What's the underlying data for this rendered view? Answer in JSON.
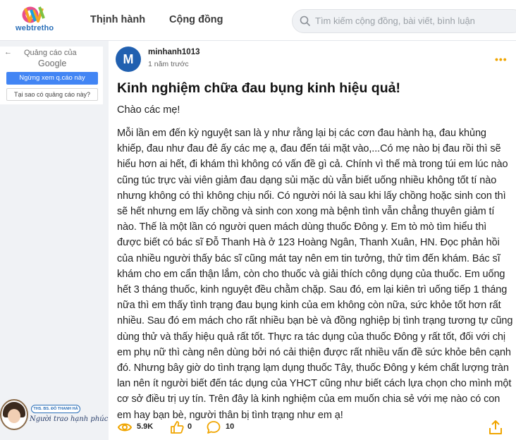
{
  "header": {
    "logo_text": "webtretho",
    "nav": [
      "Thịnh hành",
      "Cộng đồng"
    ],
    "search_placeholder": "Tìm kiếm cộng đồng, bài viết, bình luận"
  },
  "ad": {
    "back_arrow": "←",
    "label": "Quảng cáo của",
    "google": "Google",
    "stop_button": "Ngừng xem q.cáo này",
    "why_button": "Tại sao có quảng cáo này?"
  },
  "brand": {
    "tag": "THS. BS. ĐỖ THANH HÀ",
    "script": "Người trao hạnh phúc"
  },
  "post": {
    "avatar_letter": "M",
    "author": "minhanh1013",
    "time": "1 năm trước",
    "more": "•••",
    "title": "Kinh nghiệm chữa đau bụng kinh hiệu quả!",
    "greeting": "Chào các mẹ!",
    "body": "Mỗi lần em đến kỳ nguyệt san là y như rằng lại bị các cơn đau hành hạ, đau khủng khiếp, đau như đau đẻ ấy các mẹ ạ, đau đến tái mặt vào,...Có mẹ nào bị đau rồi thì sẽ hiểu hơn ai hết, đi khám thì không có vấn đề gì cả. Chính vì thế mà trong túi em lúc nào cũng túc trực vài viên giảm đau dạng sủi mặc dù vẫn biết uống nhiều không tốt tí nào nhưng không có thì không chịu nổi. Có người nói là sau khi lấy chồng hoặc sinh con thì sẽ hết nhưng em lấy chồng và sinh con xong mà bệnh tình vẫn chẳng thuyên giảm tí nào. Thế là một lần có người quen mách dùng thuốc Đông y. Em tò mò tìm hiểu thì được biết có bác sĩ Đỗ Thanh Hà ở 123 Hoàng Ngân, Thanh Xuân, HN. Đọc phản hồi của nhiều người thấy bác sĩ cũng mát tay nên em tin tưởng, thử tìm đến khám. Bác sĩ khám cho em cẩn thận lắm, còn cho thuốc và giải thích công dụng của thuốc. Em uống hết 3 tháng thuốc, kinh nguyệt đều chằm chặp. Sau đó, em lại kiên trì uống tiếp 1 tháng nữa thì em thấy tình trạng đau bụng kinh của em không còn nữa, sức khỏe tốt hơn rất nhiều. Sau đó em mách cho rất nhiều bạn bè và đồng nghiệp bị tình trạng tương tự cũng dùng thử và thấy hiệu quả rất tốt. Thực ra tác dụng của thuốc Đông y rất tốt, đối với chị em phụ nữ thì càng nên dùng bởi nó cải thiện được rất nhiều vấn đề sức khỏe bên cạnh đó. Nhưng bây giờ do tình trạng lạm dụng thuốc Tây, thuốc Đông y kém chất lượng tràn lan nên ít người biết đến tác dụng của YHCT cũng như biết cách lựa chọn cho mình một cơ sở điều trị uy tín. Trên đây là kinh nghiệm của em muốn chia sẻ với mẹ nào có con em hay bạn bè, người thân bị tình trạng như em ạ!",
    "stats": {
      "views": "5.9K",
      "likes": "0",
      "comments": "10"
    }
  },
  "colors": {
    "accent": "#f0a500",
    "avatar": "#2160b0",
    "ad_button": "#4285f4"
  },
  "icons": {
    "search": "search-icon",
    "views": "eye-icon",
    "likes": "thumbs-up-icon",
    "comments": "comment-icon",
    "share": "share-icon",
    "more": "more-dots-icon"
  }
}
